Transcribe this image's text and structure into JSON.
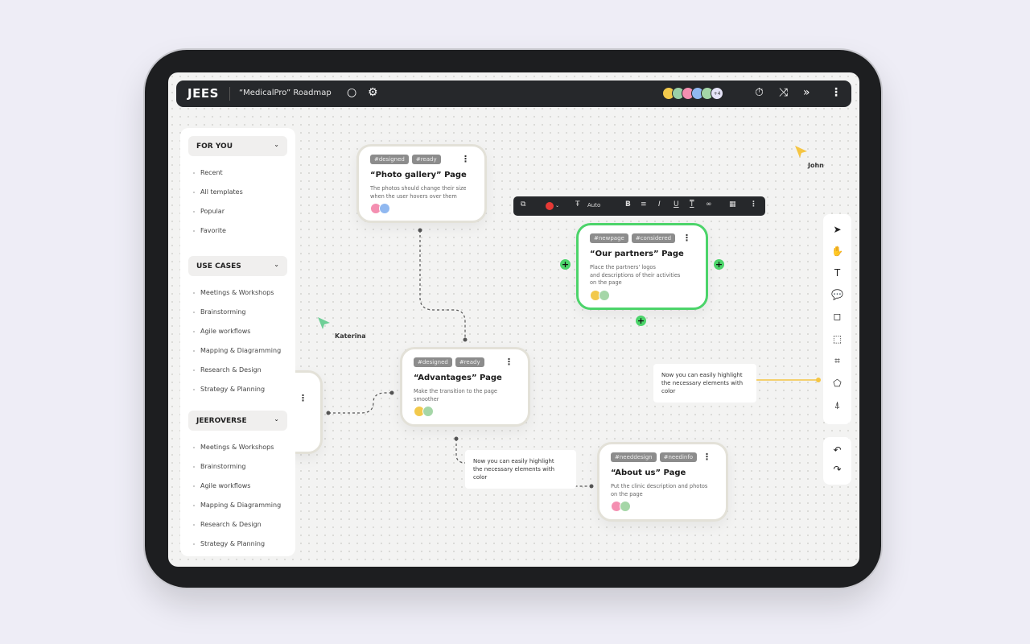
{
  "app": {
    "logo": "JEES",
    "title": "“MedicalPro” Roadmap",
    "more_users": "+4",
    "icons": [
      "search-icon",
      "gear-icon",
      "timer-icon",
      "shuffle-icon",
      "chevrons-right-icon",
      "more-vertical-icon"
    ],
    "avatar_colors": [
      "#f2c94c",
      "#9ad0a8",
      "#f48fb1",
      "#90b8f0",
      "#a5d6a7"
    ]
  },
  "sidebar": {
    "sections": [
      {
        "label": "FOR YOU",
        "items": [
          "Recent",
          "All templates",
          "Popular",
          "Favorite"
        ]
      },
      {
        "label": "USE CASES",
        "items": [
          "Meetings & Workshops",
          "Brainstorming",
          "Agile workflows",
          "Mapping & Diagramming",
          "Research & Design",
          "Strategy & Planning"
        ]
      },
      {
        "label": "JEEROVERSE",
        "items": [
          "Meetings & Workshops",
          "Brainstorming",
          "Agile workflows",
          "Mapping & Diagramming",
          "Research & Design",
          "Strategy & Planning"
        ]
      }
    ]
  },
  "cards": [
    {
      "tags": [
        "#designed",
        "#ready"
      ],
      "title": "“Photo gallery” Page",
      "desc": "The photos should change their size\nwhen the user hovers over them",
      "avatars": [
        "#f48fb1",
        "#90b8f0"
      ],
      "selected": false
    },
    {
      "tags": [
        "#newpage",
        "#considered"
      ],
      "title": "“Our partners” Page",
      "desc": "Place the partners' logos\nand descriptions of their activities\non the page",
      "avatars": [
        "#f2c94c",
        "#a5d6a7"
      ],
      "selected": true
    },
    {
      "tags": [
        "#designed",
        "#ready"
      ],
      "title": "“Advantages” Page",
      "desc": "Make the transition to the page\nsmoother",
      "avatars": [
        "#f2c94c",
        "#a5d6a7"
      ],
      "selected": false
    },
    {
      "tags": [
        "#needdesign",
        "#needinfo"
      ],
      "title": "“About us” Page",
      "desc": "Put the clinic description and photos\non the page",
      "avatars": [
        "#f48fb1",
        "#a5d6a7"
      ],
      "selected": false
    }
  ],
  "notes": [
    "Now you can easily highlight\nthe necessary elements with color",
    "Now you can easily highlight\nthe necessary elements with color"
  ],
  "cursors": [
    {
      "name": "John",
      "color": "#f5c542"
    },
    {
      "name": "Katerina",
      "color": "#6fcf97"
    }
  ],
  "format_toolbar": {
    "font_size": "Auto",
    "text_color": "#e53935",
    "icons": [
      "frame-icon",
      "color-icon",
      "text-size-icon",
      "bold-icon",
      "align-icon",
      "italic-icon",
      "underline-icon",
      "strikethrough-icon",
      "link-icon",
      "palette-icon",
      "more-vertical-icon"
    ]
  },
  "tools": [
    "pointer-icon",
    "hand-icon",
    "text-icon",
    "comment-icon",
    "sticky-note-icon",
    "select-area-icon",
    "crop-icon",
    "shape-icon",
    "pen-icon"
  ],
  "history": [
    "undo-icon",
    "redo-icon"
  ],
  "colors": {
    "accent": "#4cd46a",
    "dark": "#26282b",
    "note_line": "#f5c542"
  }
}
